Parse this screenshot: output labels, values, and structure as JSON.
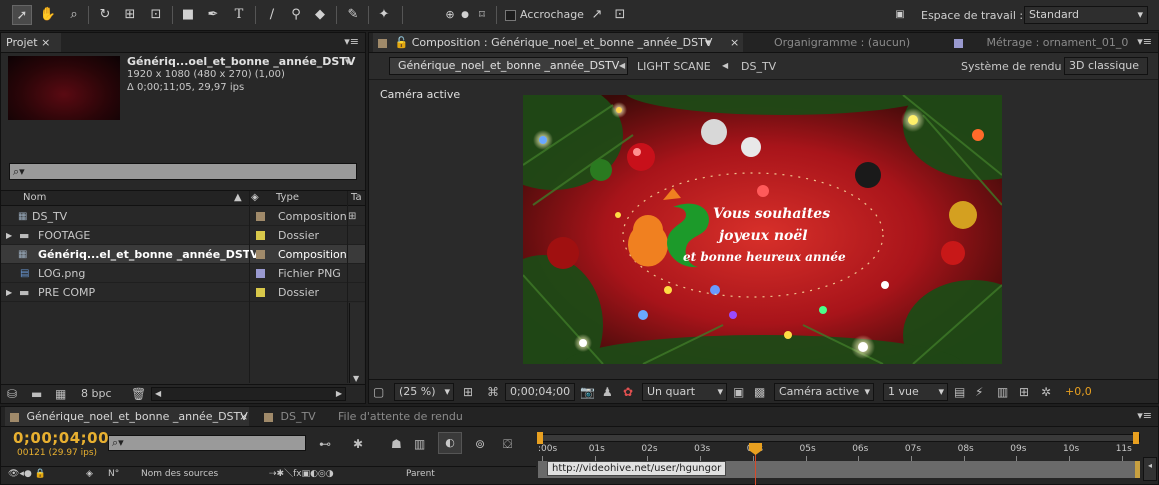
{
  "toolbar": {
    "snap_label": "Accrochage",
    "workspace_label": "Espace de travail :",
    "workspace_value": "Standard"
  },
  "project": {
    "tab_label": "Projet",
    "comp_name": "Génériq...oel_et_bonne _année_DSTV",
    "resolution": "1920 x 1080  (480 x 270) (1,00)",
    "duration": "Δ 0;00;11;05, 29,97 ips",
    "search_placeholder": "",
    "col_name": "Nom",
    "col_type": "Type",
    "col_extra": "Ta",
    "items": [
      {
        "name": "DS_TV",
        "type": "Composition",
        "color": "#a08a6a",
        "icon": "composition-icon"
      },
      {
        "name": "FOOTAGE",
        "type": "Dossier",
        "color": "#d8c84a",
        "icon": "folder-icon"
      },
      {
        "name": "Génériq...el_et_bonne _année_DSTV",
        "type": "Composition",
        "color": "#a08a6a",
        "icon": "composition-icon"
      },
      {
        "name": "LOG.png",
        "type": "Fichier PNG",
        "color": "#9a9ad0",
        "icon": "png-file-icon"
      },
      {
        "name": "PRE COMP",
        "type": "Dossier",
        "color": "#d8c84a",
        "icon": "folder-icon"
      }
    ],
    "bpc": "8 bpc"
  },
  "viewer": {
    "comp_tab": "Composition : Générique_noel_et_bonne _année_DSTV",
    "flowchart_tab": "Organigramme : (aucun)",
    "footage_tab": "Métrage : ornament_01_0",
    "breadcrumbs": [
      "Générique_noel_et_bonne _année_DSTV",
      "LIGHT SCANE",
      "DS_TV"
    ],
    "renderer_label": "Système de rendu :",
    "renderer_value": "3D classique",
    "camera_label": "Caméra active",
    "frame_text": [
      "Vous souhaites",
      "joyeux noël",
      "et bonne heureux année"
    ],
    "zoom": "(25 %)",
    "timecode": "0;00;04;00",
    "resolution": "Un quart",
    "camera": "Caméra active",
    "views": "1 vue",
    "exposure": "+0,0"
  },
  "timeline": {
    "tabs": [
      "Générique_noel_et_bonne _année_DSTV",
      "DS_TV",
      "File d'attente de rendu"
    ],
    "timecode": "0;00;04;00",
    "frame_info": "00121 (29.97 ips)",
    "col_num": "N°",
    "col_source": "Nom des sources",
    "col_parent": "Parent",
    "ticks": [
      ":00s",
      "01s",
      "02s",
      "03s",
      "04s",
      "05s",
      "06s",
      "07s",
      "08s",
      "09s",
      "10s",
      "11s"
    ],
    "tooltip": "http://videohive.net/user/hgungor",
    "playhead_time": "04s"
  },
  "colors": {
    "accent_orange": "#e8a020",
    "playhead": "#d84a2a",
    "timecode_yellow": "#e8b030"
  }
}
